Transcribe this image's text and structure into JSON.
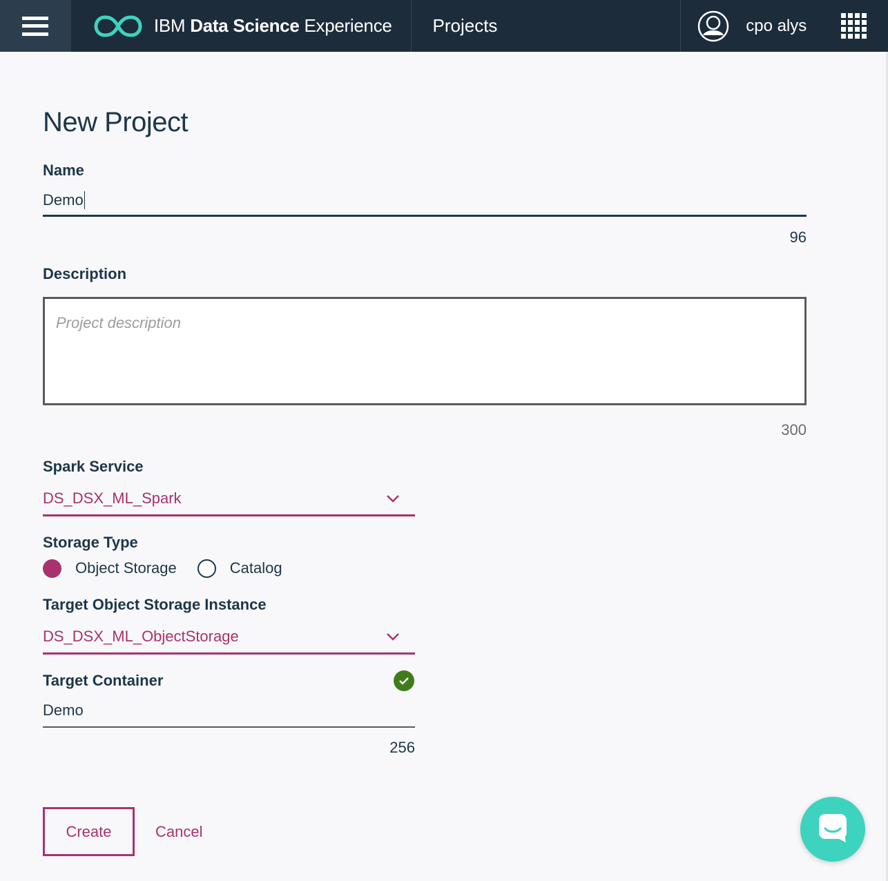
{
  "header": {
    "brand_ibm": "IBM",
    "brand_data_science": "Data Science",
    "brand_experience": "Experience",
    "nav_projects": "Projects",
    "user_name": "cpo alys"
  },
  "form": {
    "title": "New Project",
    "name": {
      "label": "Name",
      "value": "Demo",
      "remaining": "96"
    },
    "description": {
      "label": "Description",
      "placeholder": "Project description",
      "remaining": "300"
    },
    "spark_service": {
      "label": "Spark Service",
      "selected": "DS_DSX_ML_Spark"
    },
    "storage_type": {
      "label": "Storage Type",
      "options": [
        {
          "label": "Object Storage",
          "selected": true
        },
        {
          "label": "Catalog",
          "selected": false
        }
      ]
    },
    "target_instance": {
      "label": "Target Object Storage Instance",
      "selected": "DS_DSX_ML_ObjectStorage"
    },
    "target_container": {
      "label": "Target Container",
      "value": "Demo",
      "remaining": "256",
      "status": "valid"
    },
    "actions": {
      "create": "Create",
      "cancel": "Cancel"
    }
  },
  "colors": {
    "header_bg": "#1c2c3b",
    "accent": "#a8326e",
    "text": "#1d3649",
    "brand_logo": "#3dd3bf",
    "success": "#3f7c1b",
    "chat_button": "#3dd3bf"
  },
  "icons": {
    "menu": "hamburger-icon",
    "logo": "infinity-logo-icon",
    "user": "user-avatar-icon",
    "apps": "app-grid-icon",
    "dropdown": "chevron-down-icon",
    "valid": "checkmark-icon",
    "chat": "chat-bubble-icon"
  }
}
